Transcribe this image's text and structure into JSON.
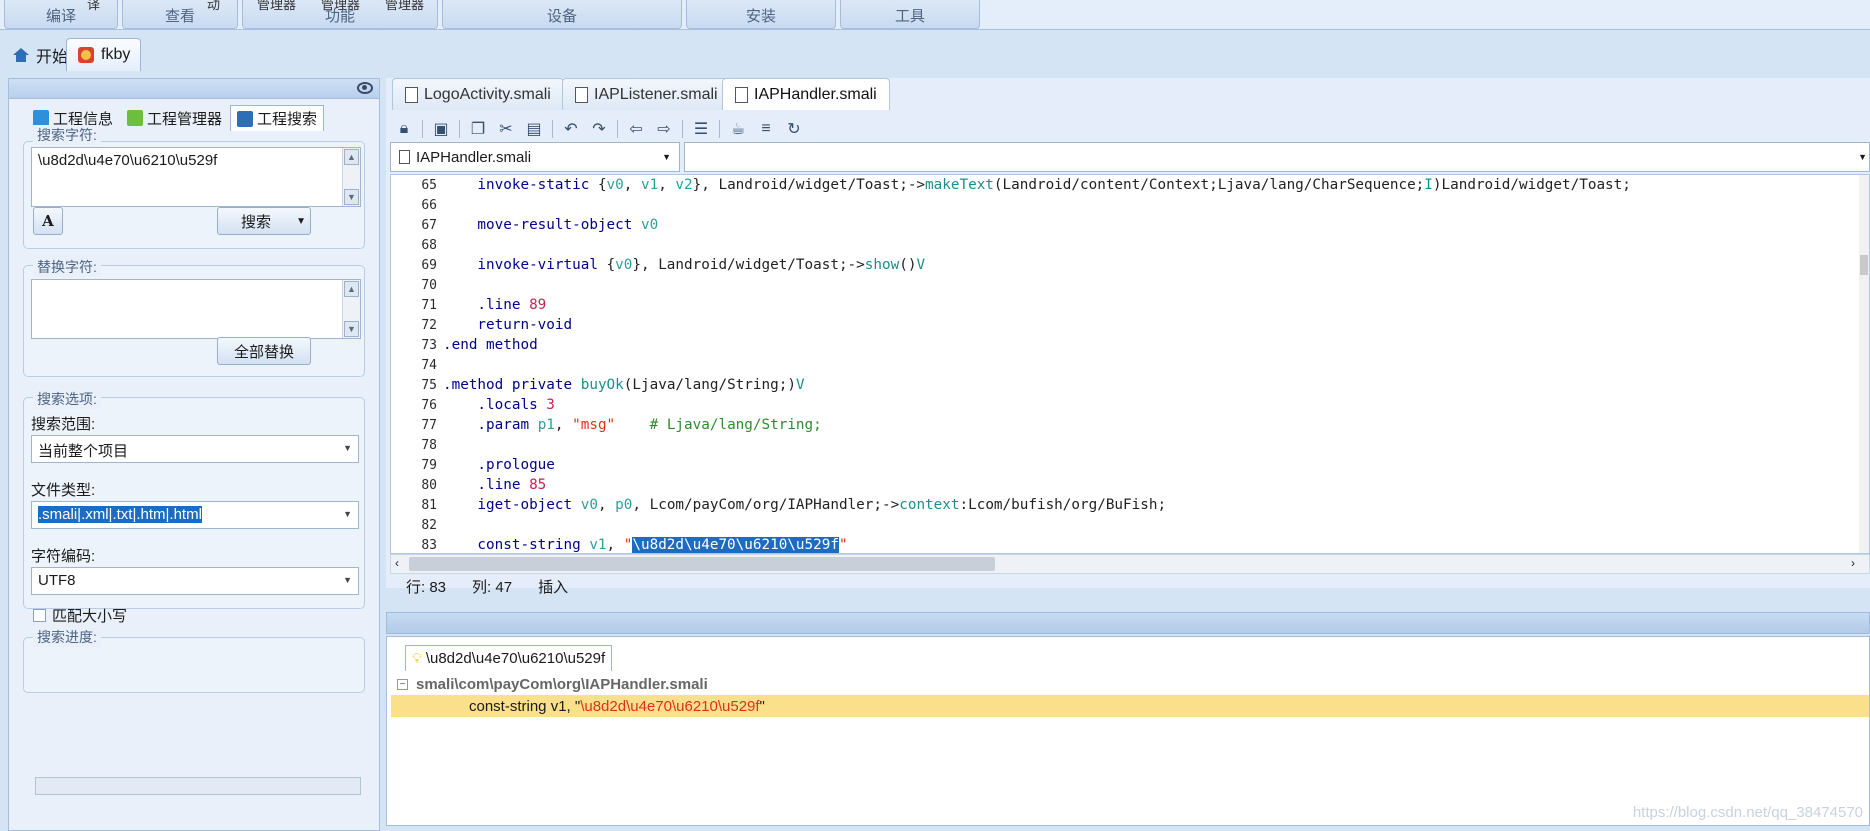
{
  "ribbon": {
    "groups": [
      {
        "label": "编译",
        "stubs": [
          "译"
        ]
      },
      {
        "label": "查看",
        "stubs": [
          "动"
        ]
      },
      {
        "label": "功能",
        "stubs": [
          "管理器",
          "管理器",
          "管理器"
        ]
      },
      {
        "label": "设备",
        "stubs": []
      },
      {
        "label": "安装",
        "stubs": []
      },
      {
        "label": "工具",
        "stubs": []
      }
    ]
  },
  "doc_tabs": {
    "home": "开始",
    "project": "fkby"
  },
  "left_panel": {
    "tabs": [
      "工程信息",
      "工程管理器",
      "工程搜索"
    ],
    "search": {
      "title": "搜索字符:",
      "value": "\\u8d2d\\u4e70\\u6210\\u529f",
      "font_button_label": "A",
      "search_button": "搜索"
    },
    "replace": {
      "title": "替换字符:",
      "value": "",
      "replace_all_button": "全部替换"
    },
    "options": {
      "title": "搜索选项:",
      "scope_label": "搜索范围:",
      "scope_value": "当前整个项目",
      "filetype_label": "文件类型:",
      "filetype_value": ".smali|.xml|.txt|.htm|.html",
      "encoding_label": "字符编码:",
      "encoding_value": "UTF8",
      "match_case_label": "匹配大小写"
    },
    "progress": {
      "title": "搜索进度:",
      "value": 0
    }
  },
  "editor": {
    "tabs": [
      "LogoActivity.smali",
      "IAPListener.smali",
      "IAPHandler.smali"
    ],
    "active_tab": 2,
    "file_combo": "IAPHandler.smali",
    "lines": [
      {
        "n": "65",
        "parts": [
          [
            "    invoke-static ",
            "kw"
          ],
          [
            "{",
            "pu"
          ],
          [
            "v0",
            "rg"
          ],
          [
            ", ",
            "pu"
          ],
          [
            "v1",
            "rg"
          ],
          [
            ", ",
            "pu"
          ],
          [
            "v2",
            "rg"
          ],
          [
            "}, Landroid/widget/Toast;->",
            "pu"
          ],
          [
            "makeText",
            "mt"
          ],
          [
            "(Landroid/content/Context;Ljava/lang/CharSequence;",
            "pu"
          ],
          [
            "I",
            "mt"
          ],
          [
            ")Landroid/widget/Toast;",
            "pu"
          ]
        ]
      },
      {
        "n": "66",
        "parts": []
      },
      {
        "n": "67",
        "parts": [
          [
            "    move-result-object ",
            "kw"
          ],
          [
            "v0",
            "rg"
          ]
        ]
      },
      {
        "n": "68",
        "parts": []
      },
      {
        "n": "69",
        "parts": [
          [
            "    invoke-virtual ",
            "kw"
          ],
          [
            "{",
            "pu"
          ],
          [
            "v0",
            "rg"
          ],
          [
            "}, Landroid/widget/Toast;->",
            "pu"
          ],
          [
            "show",
            "mt"
          ],
          [
            "()",
            "pu"
          ],
          [
            "V",
            "mt"
          ]
        ]
      },
      {
        "n": "70",
        "parts": []
      },
      {
        "n": "71",
        "parts": [
          [
            "    .line ",
            "kw"
          ],
          [
            "89",
            "nm"
          ]
        ]
      },
      {
        "n": "72",
        "parts": [
          [
            "    return-void",
            "kw"
          ]
        ]
      },
      {
        "n": "73",
        "parts": [
          [
            ".end method",
            "kw"
          ]
        ]
      },
      {
        "n": "74",
        "parts": []
      },
      {
        "n": "75",
        "parts": [
          [
            ".method private ",
            "kw"
          ],
          [
            "buyOk",
            "mt"
          ],
          [
            "(Ljava/lang/String;)",
            "pu"
          ],
          [
            "V",
            "mt"
          ]
        ]
      },
      {
        "n": "76",
        "parts": [
          [
            "    .locals ",
            "kw"
          ],
          [
            "3",
            "nm"
          ]
        ]
      },
      {
        "n": "77",
        "parts": [
          [
            "    .param ",
            "kw"
          ],
          [
            "p1",
            "rg"
          ],
          [
            ", ",
            "pu"
          ],
          [
            "\"msg\"",
            "st"
          ],
          [
            "    # Ljava/lang/String;",
            "cm"
          ]
        ]
      },
      {
        "n": "78",
        "parts": []
      },
      {
        "n": "79",
        "parts": [
          [
            "    .prologue",
            "kw"
          ]
        ]
      },
      {
        "n": "80",
        "parts": [
          [
            "    .line ",
            "kw"
          ],
          [
            "85",
            "nm"
          ]
        ]
      },
      {
        "n": "81",
        "parts": [
          [
            "    iget-object ",
            "kw"
          ],
          [
            "v0",
            "rg"
          ],
          [
            ", ",
            "pu"
          ],
          [
            "p0",
            "rg"
          ],
          [
            ", Lcom/payCom/org/IAPHandler;->",
            "pu"
          ],
          [
            "context",
            "mt"
          ],
          [
            ":Lcom/bufish/org/BuFish;",
            "pu"
          ]
        ]
      },
      {
        "n": "82",
        "parts": []
      },
      {
        "n": "83",
        "parts": [
          [
            "    const-string ",
            "kw"
          ],
          [
            "v1",
            "rg"
          ],
          [
            ", ",
            "pu"
          ],
          [
            "\"",
            "st"
          ],
          [
            "\\u8d2d\\u4e70\\u6210\\u529f",
            "hl"
          ],
          [
            "\"",
            "st"
          ]
        ]
      }
    ],
    "status": {
      "row": "行: 83",
      "col": "列: 47",
      "mode": "插入"
    }
  },
  "results": {
    "tab_label": "\\u8d2d\\u4e70\\u6210\\u529f",
    "file_path": "smali\\com\\payCom\\org\\IAPHandler.smali",
    "match_prefix": "const-string v1, \"",
    "match_text": "\\u8d2d\\u4e70\\u6210\\u529f",
    "match_suffix": "\""
  },
  "watermark": "https://blog.csdn.net/qq_38474570",
  "colors": {
    "selection": "#1d6cc2",
    "result_highlight": "#fae08a",
    "string": "#e0301e",
    "keyword": "#00008b"
  }
}
